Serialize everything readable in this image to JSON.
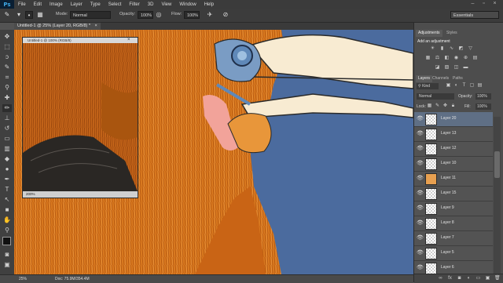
{
  "app": {
    "logo": "Ps"
  },
  "menu": [
    "File",
    "Edit",
    "Image",
    "Layer",
    "Type",
    "Select",
    "Filter",
    "3D",
    "View",
    "Window",
    "Help"
  ],
  "window_controls": {
    "minimize": "–",
    "restore": "▫",
    "close": "×"
  },
  "options": {
    "mode_label": "Mode:",
    "mode_value": "Normal",
    "opacity_label": "Opacity:",
    "opacity_value": "100%",
    "flow_label": "Flow:",
    "flow_value": "100%",
    "workspace": "Essentials"
  },
  "document_tab": "Untitled-1 @ 25% (Layer 20, RGB/8) *",
  "nav_window": {
    "title": "Untitled-1 @ 100% (RGB/8)",
    "zoom": "200%"
  },
  "status": {
    "zoom": "25%",
    "doc": "Doc: 75.9M/354.4M"
  },
  "panel": {
    "tabs_top": [
      "Adjustments",
      "Styles"
    ],
    "adjust_title": "Add an adjustment",
    "tabs_layers": [
      "Layers",
      "Channels",
      "Paths"
    ],
    "kind_label": "Kind",
    "blend_mode": "Normal",
    "opacity_label": "Opacity:",
    "opacity_value": "100%",
    "lock_label": "Lock:",
    "fill_label": "Fill:",
    "fill_value": "100%",
    "layers": [
      {
        "name": "Layer 20",
        "selected": true
      },
      {
        "name": "Layer 13",
        "selected": false
      },
      {
        "name": "Layer 12",
        "selected": false
      },
      {
        "name": "Layer 10",
        "selected": false
      },
      {
        "name": "Layer 11",
        "selected": false
      },
      {
        "name": "Layer 15",
        "selected": false
      },
      {
        "name": "Layer 9",
        "selected": false
      },
      {
        "name": "Layer 8",
        "selected": false
      },
      {
        "name": "Layer 7",
        "selected": false
      },
      {
        "name": "Layer 5",
        "selected": false
      },
      {
        "name": "Layer 6",
        "selected": false
      }
    ]
  },
  "colors": {
    "canvas_bg": "#4b6b9e",
    "feather_orange": "#d9791f",
    "beak_cream": "#f8ebd2",
    "eye_blue": "#7a9cc4",
    "cheek_pink": "#f2a39a",
    "selected_layer": "#5f6f85"
  }
}
